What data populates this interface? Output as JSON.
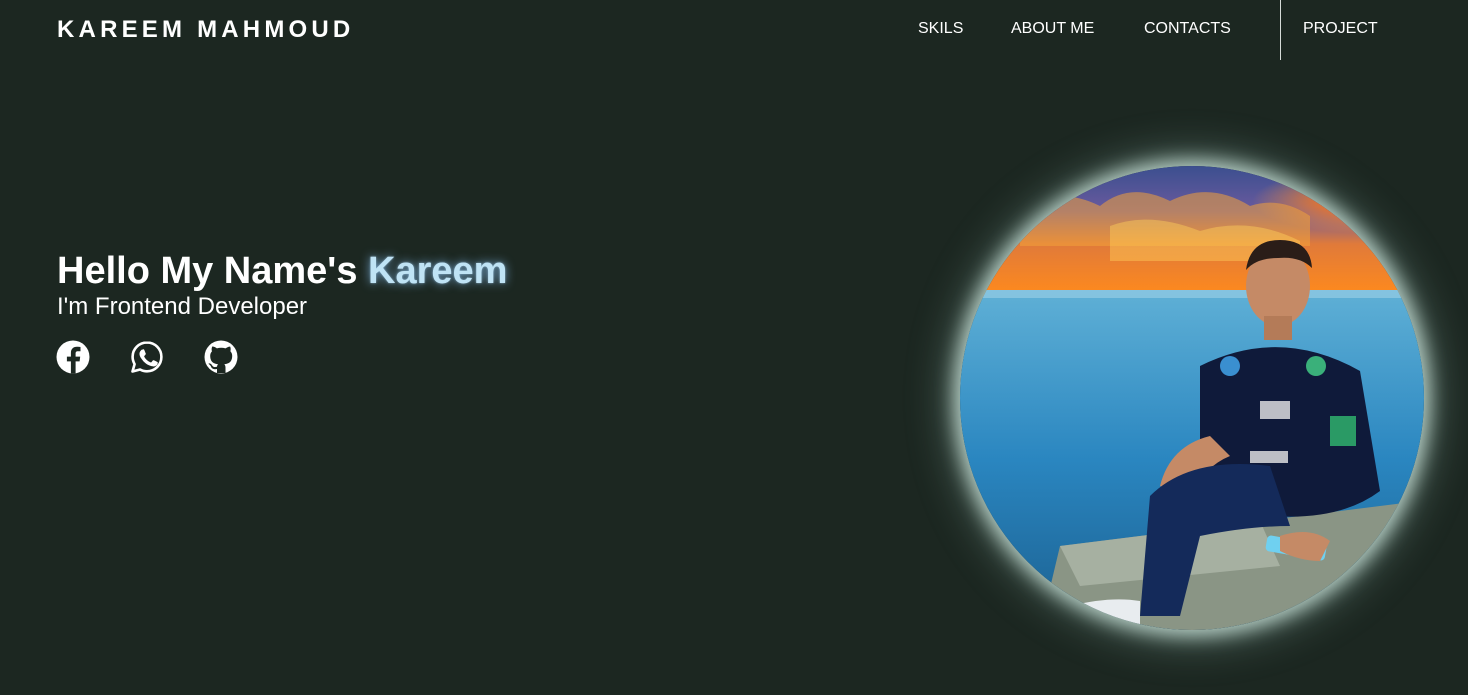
{
  "header": {
    "brand": "KAREEM MAHMOUD",
    "nav": {
      "skils": "SKILS",
      "about": "ABOUT ME",
      "contacts": "CONTACTS",
      "project": "PROJECT"
    }
  },
  "hero": {
    "greeting": "Hello My Name's ",
    "name": "Kareem",
    "subtitle": "I'm Frontend Developer",
    "social": [
      {
        "icon": "facebook-icon"
      },
      {
        "icon": "whatsapp-icon"
      },
      {
        "icon": "github-icon"
      }
    ]
  },
  "colors": {
    "background": "#1c2721",
    "accent_name": "#bfe3f5",
    "text": "#ffffff"
  }
}
